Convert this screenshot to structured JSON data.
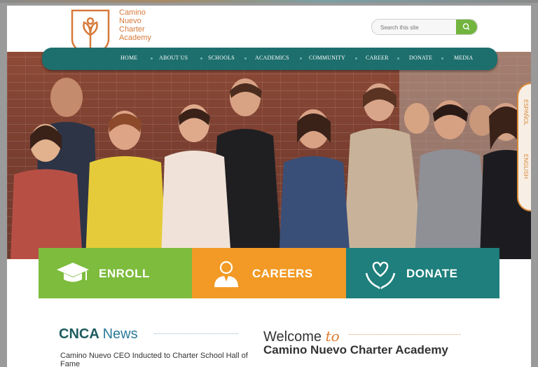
{
  "brand": {
    "name_lines": [
      "Camino",
      "Nuevo",
      "Charter",
      "Academy"
    ],
    "color": "#d77a3a"
  },
  "search": {
    "placeholder": "Search this site",
    "button_icon": "search-icon"
  },
  "nav": {
    "items": [
      "HOME",
      "ABOUT US",
      "SCHOOLS",
      "ACADEMICS",
      "COMMUNITY",
      "CAREER",
      "DONATE",
      "MEDIA"
    ]
  },
  "language_tab": {
    "items": [
      "ESPAÑOL",
      "ENGLISH"
    ]
  },
  "cta": {
    "enroll": {
      "label": "ENROLL",
      "icon": "graduation-cap-icon",
      "color": "#7dbc3d"
    },
    "careers": {
      "label": "CAREERS",
      "icon": "person-icon",
      "color": "#f29a25"
    },
    "donate": {
      "label": "DONATE",
      "icon": "heart-hands-icon",
      "color": "#1e7f7c"
    }
  },
  "news": {
    "title_main": "CNCA",
    "title_accent": "News",
    "first_item": "Camino Nuevo CEO Inducted to Charter School Hall of Fame"
  },
  "welcome": {
    "prefix": "Welcome",
    "to": "to",
    "subtitle": "Camino Nuevo Charter Academy"
  },
  "colors": {
    "nav": "#1d6f6d",
    "accent_orange": "#e07b2e",
    "news_blue": "#2b7a99"
  }
}
